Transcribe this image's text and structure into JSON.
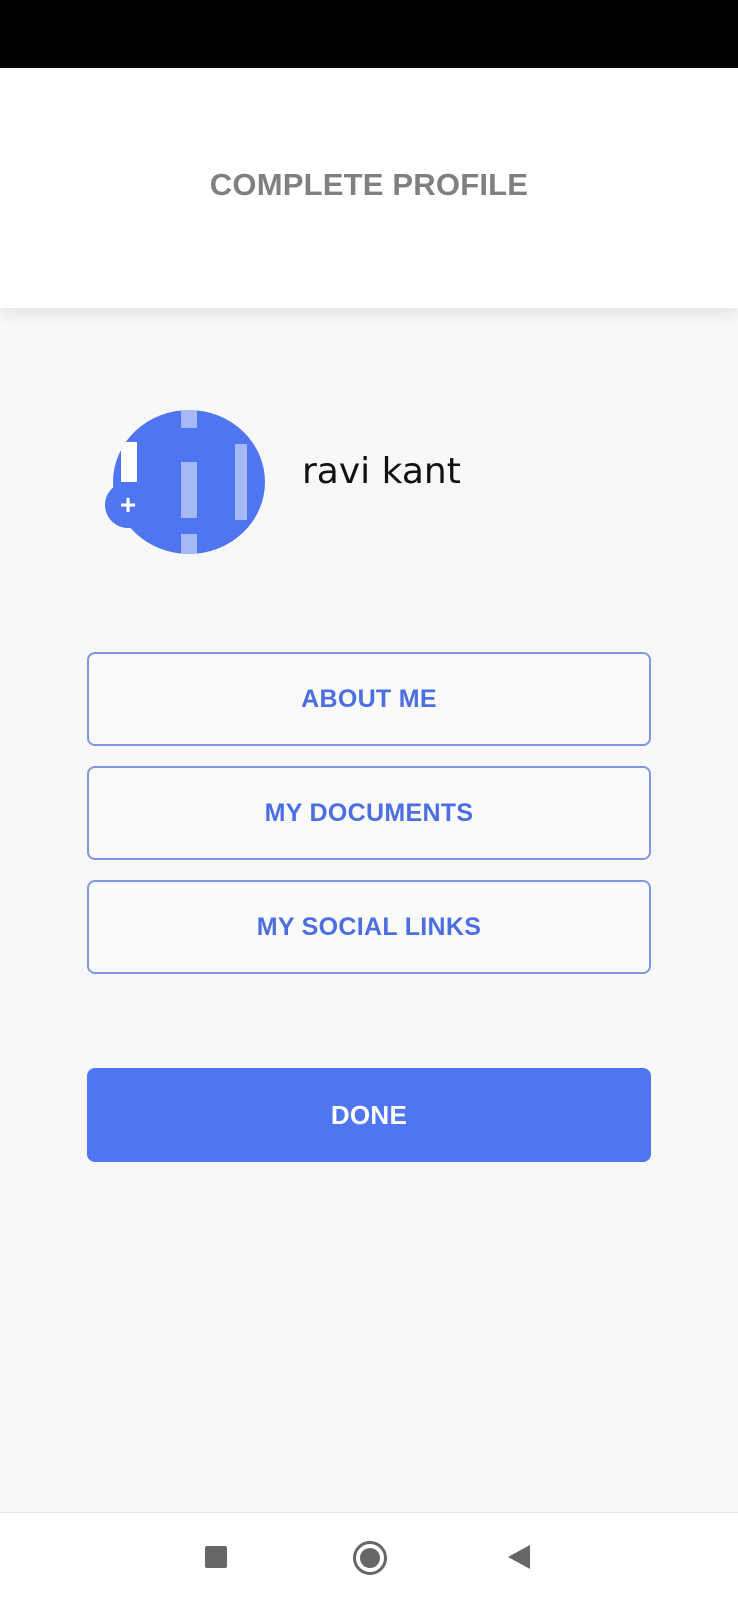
{
  "header": {
    "title": "COMPLETE PROFILE"
  },
  "profile": {
    "name": "ravi kant",
    "add_photo_icon": "plus-icon"
  },
  "menu": {
    "about_label": "ABOUT ME",
    "documents_label": "MY DOCUMENTS",
    "social_label": "MY SOCIAL LINKS"
  },
  "actions": {
    "done_label": "DONE"
  },
  "nav": {
    "icons": [
      "square-recent-apps-icon",
      "circle-home-icon",
      "triangle-back-icon"
    ]
  },
  "colors": {
    "accent": "#4f76f0",
    "outline_border": "#7f97e4",
    "outline_text": "#4c6ee3",
    "title_text": "#808080",
    "background": "#f8f8f8"
  }
}
